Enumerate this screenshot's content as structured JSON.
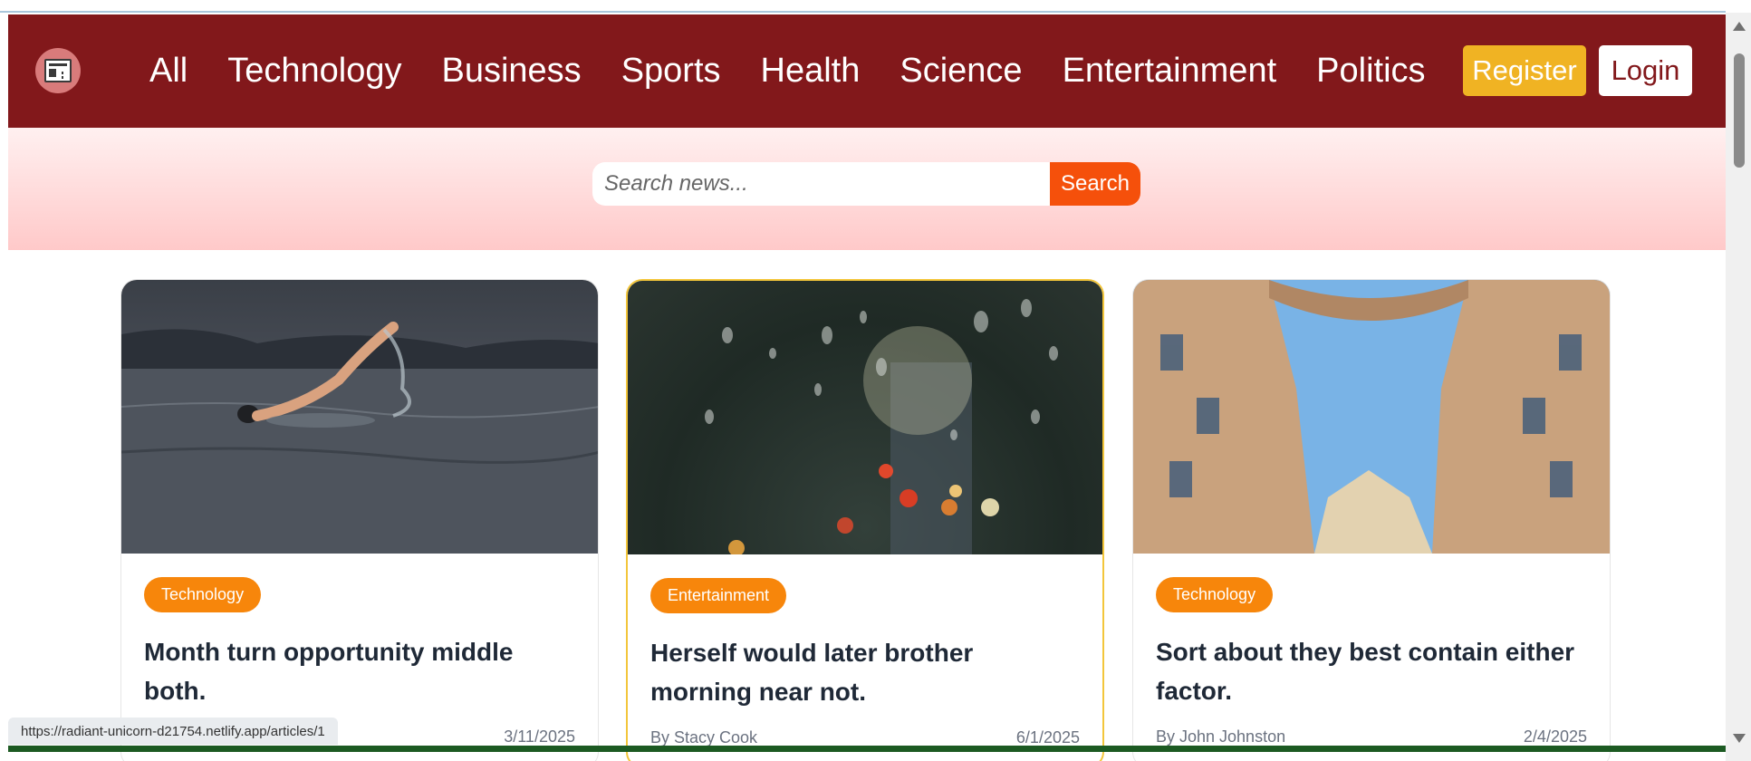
{
  "header": {
    "nav": [
      "All",
      "Technology",
      "Business",
      "Sports",
      "Health",
      "Science",
      "Entertainment",
      "Politics"
    ],
    "register_label": "Register",
    "login_label": "Login",
    "colors": {
      "nav_bg": "#82181b",
      "register_bg": "#f0b323",
      "accent": "#f7860b"
    }
  },
  "search": {
    "placeholder": "Search news...",
    "button_label": "Search"
  },
  "cards": [
    {
      "category": "Technology",
      "title": "Month turn opportunity middle both.",
      "author": "",
      "date": "3/11/2025",
      "image": "swimmer-in-lake"
    },
    {
      "category": "Entertainment",
      "title": "Herself would later brother morning near not.",
      "author": "By Stacy Cook",
      "date": "6/1/2025",
      "image": "raindrops-on-window"
    },
    {
      "category": "Technology",
      "title": "Sort about they best contain either factor.",
      "author": "By John Johnston",
      "date": "2/4/2025",
      "image": "buildings-looking-up"
    }
  ],
  "status_bar": {
    "url": "https://radiant-unicorn-d21754.netlify.app/articles/1"
  }
}
